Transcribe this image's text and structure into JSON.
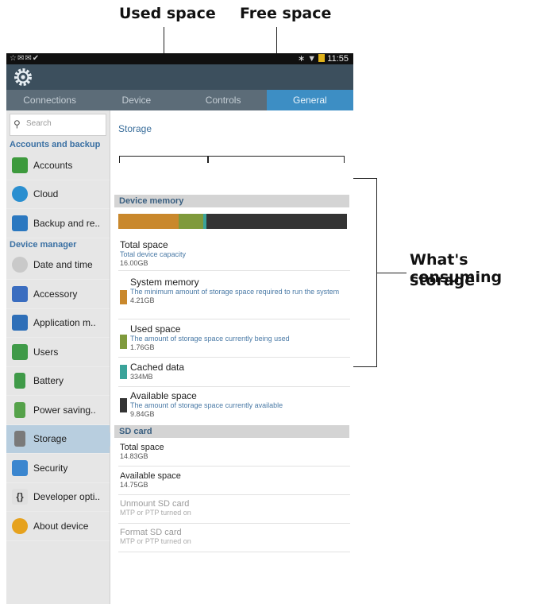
{
  "callouts": {
    "used_space": "Used space",
    "free_space": "Free space",
    "consuming": "What's consuming",
    "storage": "storage"
  },
  "statusbar": {
    "left_icons": "☆✉✉✔",
    "time": "11:55"
  },
  "tabs": [
    "Connections",
    "Device",
    "Controls",
    "General"
  ],
  "sidebar": {
    "search_placeholder": "Search",
    "section1": "Accounts and backup",
    "section2": "Device manager",
    "items": [
      {
        "label": "Accounts",
        "color": "#3d9a3d"
      },
      {
        "label": "Cloud",
        "color": "#2a8fd0"
      },
      {
        "label": "Backup and re..",
        "color": "#2b78c0"
      },
      {
        "label": "Date and time",
        "color": "#c9c9c9"
      },
      {
        "label": "Accessory",
        "color": "#3a6dc0"
      },
      {
        "label": "Application m..",
        "color": "#2e6fb8"
      },
      {
        "label": "Users",
        "color": "#3f9a48"
      },
      {
        "label": "Battery",
        "color": "#3f9a48"
      },
      {
        "label": "Power saving..",
        "color": "#55a24a"
      },
      {
        "label": "Storage",
        "color": "#7a7a7a"
      },
      {
        "label": "Security",
        "color": "#3b86cf"
      },
      {
        "label": "Developer opti..",
        "color": "#e0e0e0"
      },
      {
        "label": "About device",
        "color": "#e6a21e"
      }
    ]
  },
  "content": {
    "breadcrumb": "Storage",
    "device_memory_header": "Device memory",
    "bar_segments": [
      {
        "name": "System memory",
        "fraction": 0.263,
        "color": "#c9882c"
      },
      {
        "name": "Used space",
        "fraction": 0.11,
        "color": "#7f9a3c"
      },
      {
        "name": "Cached data",
        "fraction": 0.012,
        "color": "#3aa39a"
      },
      {
        "name": "Available space",
        "fraction": 0.615,
        "color": "#343434"
      }
    ],
    "total_space": {
      "title": "Total space",
      "desc": "Total device capacity",
      "value": "16.00GB"
    },
    "system_memory": {
      "title": "System memory",
      "desc": "The minimum amount of storage space required to run the system",
      "value": "4.21GB",
      "color": "#c9882c"
    },
    "used_space": {
      "title": "Used space",
      "desc": "The amount of storage space currently being used",
      "value": "1.76GB",
      "color": "#7f9a3c"
    },
    "cached_data": {
      "title": "Cached data",
      "value": "334MB",
      "color": "#3aa39a"
    },
    "available_space": {
      "title": "Available space",
      "desc": "The amount of storage space currently available",
      "value": "9.84GB",
      "color": "#343434"
    },
    "sd_header": "SD card",
    "sd_total": {
      "title": "Total space",
      "value": "14.83GB"
    },
    "sd_available": {
      "title": "Available space",
      "value": "14.75GB"
    },
    "unmount": {
      "title": "Unmount SD card",
      "desc": "MTP or PTP turned on"
    },
    "format": {
      "title": "Format SD card",
      "desc": "MTP or PTP turned on"
    }
  }
}
